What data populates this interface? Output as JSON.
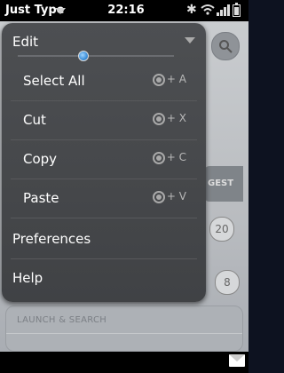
{
  "status_bar": {
    "app_title": "Just Type",
    "clock": "22:16",
    "icons": [
      "chevron-down-icon",
      "bluetooth-icon",
      "wifi-icon",
      "signal-icon",
      "battery-icon"
    ]
  },
  "menu": {
    "header_label": "Edit",
    "items": [
      {
        "label": "Select All",
        "shortcut": "+ A"
      },
      {
        "label": "Cut",
        "shortcut": "+ X"
      },
      {
        "label": "Copy",
        "shortcut": "+ C"
      },
      {
        "label": "Paste",
        "shortcut": "+ V"
      }
    ],
    "preferences_label": "Preferences",
    "help_label": "Help"
  },
  "background": {
    "suggest_label": "GEST",
    "count_1": "20",
    "count_2": "8",
    "section_label": "LAUNCH & SEARCH"
  },
  "colors": {
    "menu_background": "#464749",
    "slider_accent": "#3c8ed8"
  }
}
